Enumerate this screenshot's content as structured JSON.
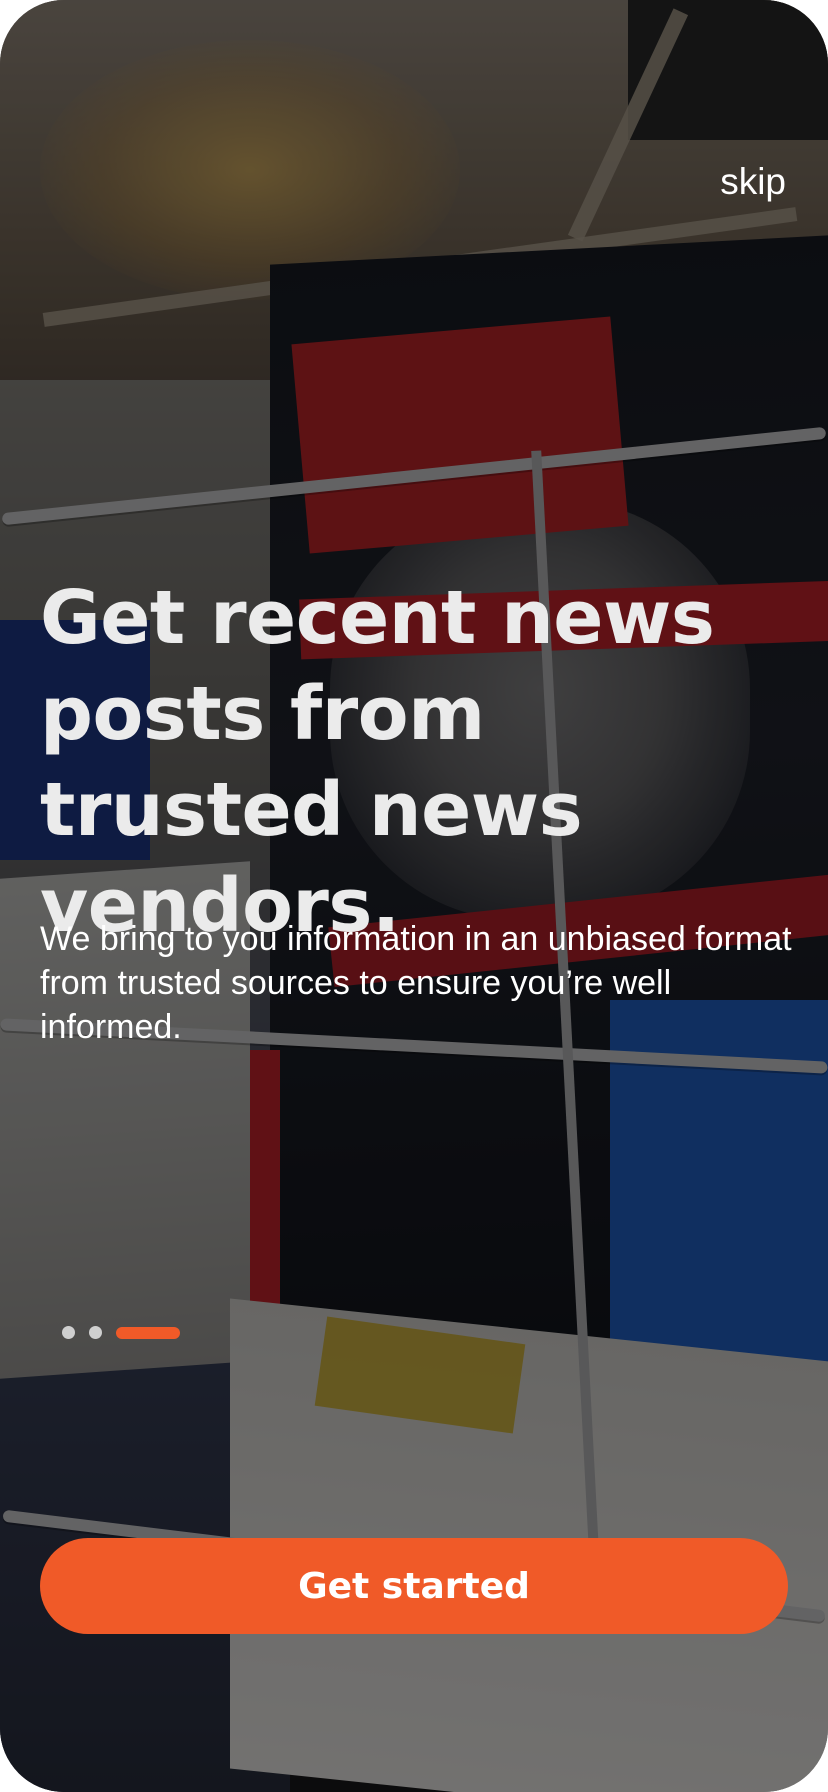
{
  "onboarding": {
    "skip_label": "skip",
    "headline": "Get recent news posts from trusted news vendors.",
    "subtext": "We bring to you information in an unbiased format from trusted sources to ensure you’re well informed.",
    "pagination": {
      "total_pages": 3,
      "current_page": 3
    },
    "cta_label": "Get started",
    "background_image": "newsstand-magazines-photo"
  },
  "colors": {
    "accent": "#f05a28",
    "inactive_dot": "#cfcfcf",
    "text": "#ffffff",
    "overlay": "rgba(0,0,0,0.52)"
  }
}
